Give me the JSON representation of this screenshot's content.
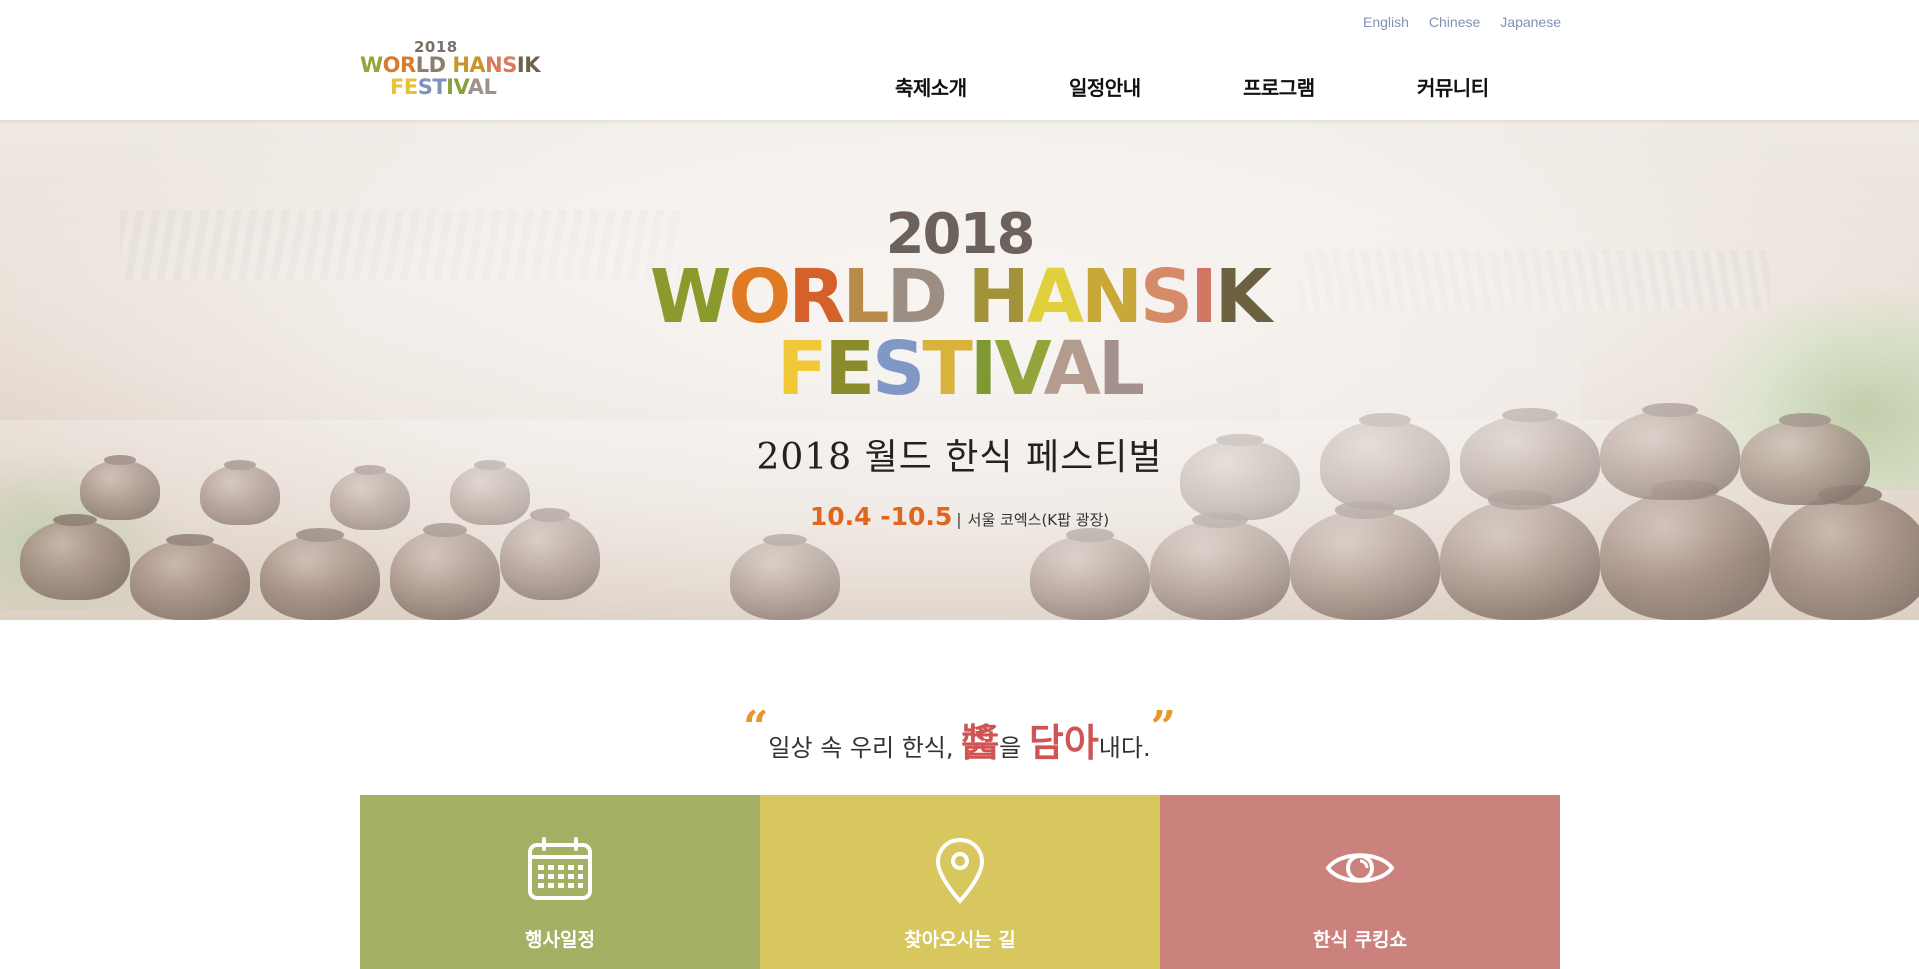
{
  "header": {
    "logo": {
      "year": "2018",
      "line1": "WORLD HANSIK",
      "line2": "FESTIVAL"
    },
    "languages": [
      "English",
      "Chinese",
      "Japanese"
    ],
    "nav": [
      "축제소개",
      "일정안내",
      "프로그램",
      "커뮤니티"
    ]
  },
  "hero": {
    "year": "2018",
    "title_line1": "WORLD HANSIK",
    "title_line2": "FESTIVAL",
    "subtitle": "2018 월드 한식 페스티벌",
    "date": "10.4 -10.5",
    "separator": "|",
    "venue": "서울 코엑스(K팝 광장)"
  },
  "slogan": {
    "open_quote": "“",
    "part1": "일상 속 우리 한식, ",
    "highlight1": "醬",
    "part2": "을 ",
    "highlight2": "담아",
    "part3": "내다.",
    "close_quote": "”"
  },
  "features": [
    {
      "label": "행사일정",
      "icon": "calendar-icon",
      "color": "#a4b063"
    },
    {
      "label": "찾아오시는 길",
      "icon": "map-pin-icon",
      "color": "#d8c65e"
    },
    {
      "label": "한식 쿠킹쇼",
      "icon": "eye-icon",
      "color": "#cc827c"
    }
  ],
  "colors": {
    "accent_orange": "#e0661e",
    "slogan_red": "#cf5453",
    "quote_orange": "#e8962a",
    "lang_link": "#7f93b0"
  }
}
